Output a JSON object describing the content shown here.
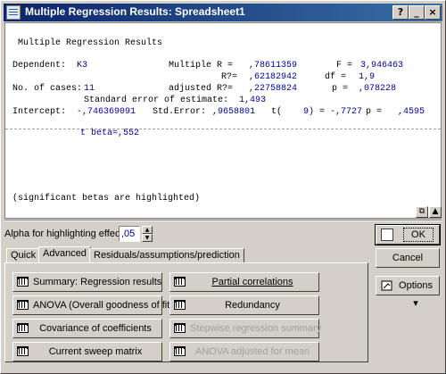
{
  "window": {
    "title": "Multiple Regression Results: Spreadsheet1",
    "btn_help": "?",
    "btn_min": "_",
    "btn_close": "×"
  },
  "output": {
    "heading": "Multiple Regression Results",
    "dependent_label": "Dependent:",
    "dependent_value": "K3",
    "multiple_r_label": "Multiple R =",
    "multiple_r_value": ",78611359",
    "f_label": "F =",
    "f_value": "3,946463",
    "r2_label": "R?=",
    "r2_value": ",62182942",
    "df_label": "df =",
    "df_value": "1,9",
    "cases_label": "No. of cases:",
    "cases_value": "11",
    "adj_r2_label": "adjusted R?=",
    "adj_r2_value": ",22758824",
    "p_label": "p =",
    "p_value": ",078228",
    "se_label": "Standard error of estimate:",
    "se_value": "1,493",
    "intercept_label": "Intercept:",
    "intercept_value": "-,746369091",
    "std_error_label": "Std.Error:",
    "std_error_value": ",9658801",
    "t_label": "t(",
    "t_df": "9)",
    "t_eq": "=",
    "t_value": "-,7727",
    "p2_label": "p =",
    "p2_value": ",4595",
    "tbeta": "t beta=,552",
    "footnote": "(significant betas are highlighted)"
  },
  "alpha": {
    "label": "Alpha for highlighting effects:",
    "value": ",05",
    "up": "▲",
    "down": "▼"
  },
  "tabs": [
    {
      "label": "Quick"
    },
    {
      "label": "Advanced"
    },
    {
      "label": "Residuals/assumptions/prediction"
    }
  ],
  "buttons": {
    "summary": "Summary:  Regression results",
    "partial": "Partial correlations",
    "anova": "ANOVA (Overall goodness of fit)",
    "redundancy": "Redundancy",
    "covariance": "Covariance of coefficients",
    "stepwise": "Stepwise regression summary",
    "sweep": "Current sweep matrix",
    "anova_adj": "ANOVA adjusted for mean"
  },
  "right": {
    "ok": "OK",
    "cancel": "Cancel",
    "options": "Options ▾"
  },
  "scroll_buttons": {
    "copy": "⧉",
    "up": "▲"
  }
}
